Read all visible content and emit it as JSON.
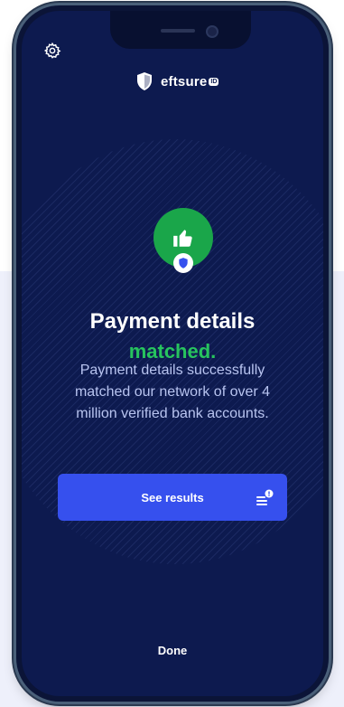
{
  "app": {
    "brand_name": "eftsure",
    "brand_badge": "ID"
  },
  "header": {
    "settings_icon": "gear-icon"
  },
  "status": {
    "icon": "thumbs-up-icon",
    "badge_icon": "shield-icon",
    "title": "Payment details",
    "result": "matched.",
    "description": "Payment details successfully matched our network of over 4 million verified bank accounts."
  },
  "actions": {
    "see_results_label": "See results",
    "see_results_icon": "list-alert-icon",
    "done_label": "Done"
  },
  "colors": {
    "screen_bg": "#0d1a4f",
    "accent_green": "#27c45e",
    "button_blue": "#3650ee",
    "description_text": "#b8c4f0"
  }
}
